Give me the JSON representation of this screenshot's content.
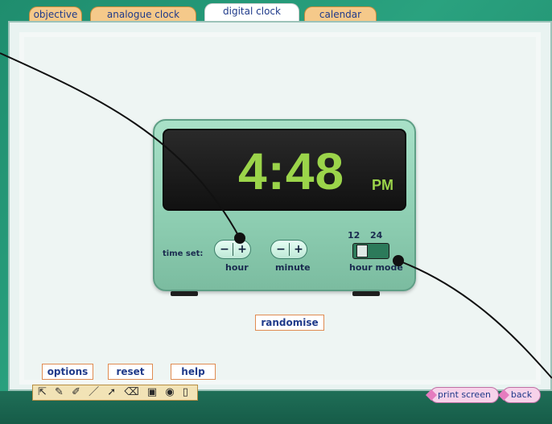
{
  "tabs": {
    "items": [
      {
        "label": "objective"
      },
      {
        "label": "analogue clock"
      },
      {
        "label": "digital clock"
      },
      {
        "label": "calendar"
      }
    ],
    "active_index": 2
  },
  "clock": {
    "time": "4:48",
    "ampm": "PM",
    "controls": {
      "time_set_label": "time set:",
      "hour_label": "hour",
      "minute_label": "minute",
      "minus_glyph": "−",
      "plus_glyph": "+"
    },
    "hour_mode": {
      "label": "hour mode",
      "option_12": "12",
      "option_24": "24",
      "selected": "12"
    }
  },
  "actions": {
    "randomise": "randomise",
    "options": "options",
    "reset": "reset",
    "help": "help"
  },
  "bottom": {
    "print_screen": "print screen",
    "back": "back",
    "tools": [
      "pointer-icon",
      "pencil-icon",
      "marker-icon",
      "line-icon",
      "arrow-icon",
      "eraser-icon",
      "save-icon",
      "view-icon",
      "page-icon"
    ]
  },
  "colors": {
    "background": "#1f8d6e",
    "digit": "#9bd44a",
    "tab": "#f5c98a",
    "button_border": "#e08b51",
    "text_blue": "#1f3a8a"
  }
}
